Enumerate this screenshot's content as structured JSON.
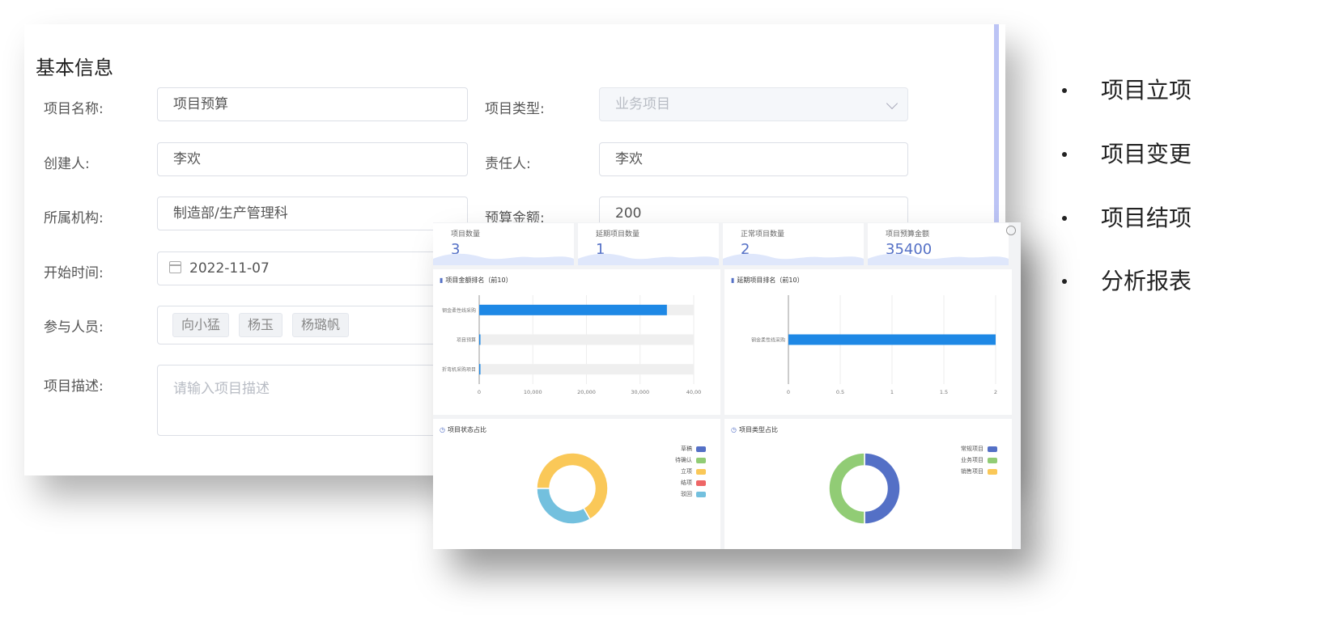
{
  "form": {
    "section_title": "基本信息",
    "fields": {
      "project_name": {
        "label": "项目名称:",
        "value": "项目预算"
      },
      "project_type": {
        "label": "项目类型:",
        "value": "业务项目"
      },
      "creator": {
        "label": "创建人:",
        "value": "李欢"
      },
      "owner": {
        "label": "责任人:",
        "value": "李欢"
      },
      "org": {
        "label": "所属机构:",
        "value": "制造部/生产管理科"
      },
      "budget": {
        "label": "预算金额:",
        "value": "200"
      },
      "start_date": {
        "label": "开始时间:",
        "value": "2022-11-07"
      },
      "members": {
        "label": "参与人员:",
        "tags": [
          "向小猛",
          "杨玉",
          "杨璐帆"
        ]
      },
      "description": {
        "label": "项目描述:",
        "placeholder": "请输入项目描述"
      }
    }
  },
  "dashboard": {
    "kpis": [
      {
        "title": "项目数量",
        "value": "3"
      },
      {
        "title": "延期项目数量",
        "value": "1"
      },
      {
        "title": "正常项目数量",
        "value": "2"
      },
      {
        "title": "项目预算金额",
        "value": "35400"
      }
    ],
    "colors": {
      "blue": "#5470c6",
      "green": "#91cc75",
      "yellow": "#fac858",
      "red": "#ee6666",
      "cyan": "#73c0de",
      "bar": "#1e88e5"
    }
  },
  "chart_data": [
    {
      "type": "bar",
      "orientation": "horizontal",
      "title": "项目金额排名（前10）",
      "categories": [
        "钢金柔性线采购",
        "项目预算",
        "折弯机采购项目"
      ],
      "values": [
        35000,
        200,
        200
      ],
      "xlim": [
        0,
        40000
      ],
      "xticks": [
        "0",
        "10,000",
        "20,000",
        "30,000",
        "40,00"
      ],
      "grid": true
    },
    {
      "type": "bar",
      "orientation": "horizontal",
      "title": "延期项目排名（前10）",
      "categories": [
        "钢金柔性线采购"
      ],
      "values": [
        2
      ],
      "xlim": [
        0,
        2
      ],
      "xticks": [
        "0",
        "0.5",
        "1",
        "1.5",
        "2"
      ],
      "grid": true
    },
    {
      "type": "pie",
      "title": "项目状态占比",
      "legend": [
        "草稿",
        "待确认",
        "立项",
        "结项",
        "驳回"
      ],
      "colors": [
        "#5470c6",
        "#91cc75",
        "#fac858",
        "#ee6666",
        "#73c0de"
      ],
      "values": [
        0,
        0,
        2,
        0,
        1
      ],
      "legend_position": "top-right"
    },
    {
      "type": "pie",
      "title": "项目类型占比",
      "legend": [
        "常规项目",
        "业务项目",
        "销售项目"
      ],
      "colors": [
        "#5470c6",
        "#91cc75",
        "#fac858"
      ],
      "values": [
        1,
        1,
        0
      ],
      "legend_position": "top-right"
    }
  ],
  "bullets": [
    "项目立项",
    "项目变更",
    "项目结项",
    "分析报表"
  ]
}
